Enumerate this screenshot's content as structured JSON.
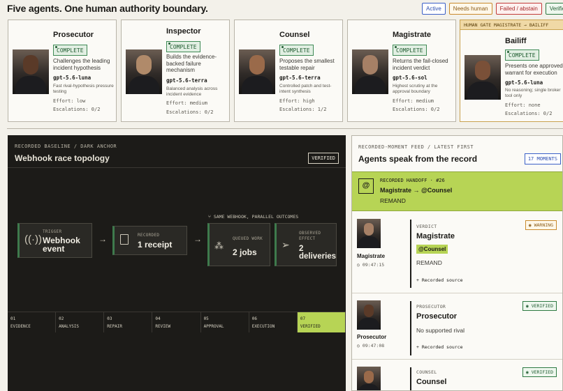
{
  "header": {
    "title": "Five agents. One human authority boundary.",
    "legend": [
      "Active",
      "Needs human",
      "Failed / abstain",
      "Verified"
    ]
  },
  "agents": [
    {
      "name": "Prosecutor",
      "status": "COMPLETE",
      "desc": "Challenges the leading incident hypothesis",
      "model": "gpt-5.6-luna",
      "note": "Fast rival-hypothesis pressure testing",
      "effort": "Effort: low",
      "escalations": "Escalations: 0/2"
    },
    {
      "name": "Inspector",
      "status": "COMPLETE",
      "desc": "Builds the evidence-backed failure mechanism",
      "model": "gpt-5.6-terra",
      "note": "Balanced analysis across incident evidence",
      "effort": "Effort: medium",
      "escalations": "Escalations: 0/2"
    },
    {
      "name": "Counsel",
      "status": "COMPLETE",
      "desc": "Proposes the smallest testable repair",
      "model": "gpt-5.6-terra",
      "note": "Controlled patch and test-intent synthesis",
      "effort": "Effort: high",
      "escalations": "Escalations: 1/2"
    },
    {
      "name": "Magistrate",
      "status": "COMPLETE",
      "desc": "Returns the fail-closed incident verdict",
      "model": "gpt-5.6-sol",
      "note": "Highest scrutiny at the approval boundary",
      "effort": "Effort: medium",
      "escalations": "Escalations: 0/2"
    },
    {
      "name": "Bailiff",
      "status": "COMPLETE",
      "desc": "Presents one approved warrant for execution",
      "model": "gpt-5.6-luna",
      "note": "No reasoning; single broker tool only",
      "effort": "Effort: none",
      "escalations": "Escalations: 0/2",
      "gate": "HUMAN GATE    MAGISTRATE → BAILIFF"
    }
  ],
  "topology": {
    "eyebrow": "RECORDED BASELINE / DARK ANCHOR",
    "title": "Webhook race topology",
    "badge": "VERIFIED",
    "parallel_note": "SAME WEBHOOK, PARALLEL OUTCOMES",
    "nodes": [
      {
        "label": "TRIGGER",
        "value": "Webhook event"
      },
      {
        "label": "RECORDED",
        "value": "1 receipt"
      },
      {
        "label": "QUEUED WORK",
        "value": "2 jobs"
      },
      {
        "label": "OBSERVED EFFECT",
        "value": "2 deliveries"
      }
    ],
    "steps": [
      {
        "num": "01",
        "label": "EVIDENCE"
      },
      {
        "num": "02",
        "label": "ANALYSIS"
      },
      {
        "num": "03",
        "label": "REPAIR"
      },
      {
        "num": "04",
        "label": "REVIEW"
      },
      {
        "num": "05",
        "label": "APPROVAL"
      },
      {
        "num": "06",
        "label": "EXECUTION"
      },
      {
        "num": "07",
        "label": "VERIFIED"
      }
    ]
  },
  "feed": {
    "eyebrow": "RECORDED-MOMENT FEED / LATEST FIRST",
    "title": "Agents speak from the record",
    "count": "17 MOMENTS",
    "handoff": {
      "kicker": "RECORDED HANDOFF · #26",
      "route": "Magistrate → @Counsel",
      "action": "REMAND"
    },
    "entries": [
      {
        "who": "Magistrate",
        "time": "09:47:15",
        "role": "VERDICT",
        "name": "Magistrate",
        "mention": "@Counsel",
        "text": "REMAND",
        "source": "+ Recorded source",
        "tag": "WARNING"
      },
      {
        "who": "Prosecutor",
        "time": "09:47:08",
        "role": "PROSECUTOR",
        "name": "Prosecutor",
        "text": "No supported rival",
        "source": "+ Recorded source",
        "tag": "VERIFIED"
      },
      {
        "who": "Counsel",
        "role": "COUNSEL",
        "name": "Counsel",
        "tag": "VERIFIED"
      }
    ]
  },
  "colors": {
    "accent_lime": "#b7d455",
    "dark_panel": "#1c1b18",
    "verified": "#2e7a42",
    "warning": "#c98a2d",
    "active": "#3a5fc7",
    "failed": "#c23a3a"
  }
}
